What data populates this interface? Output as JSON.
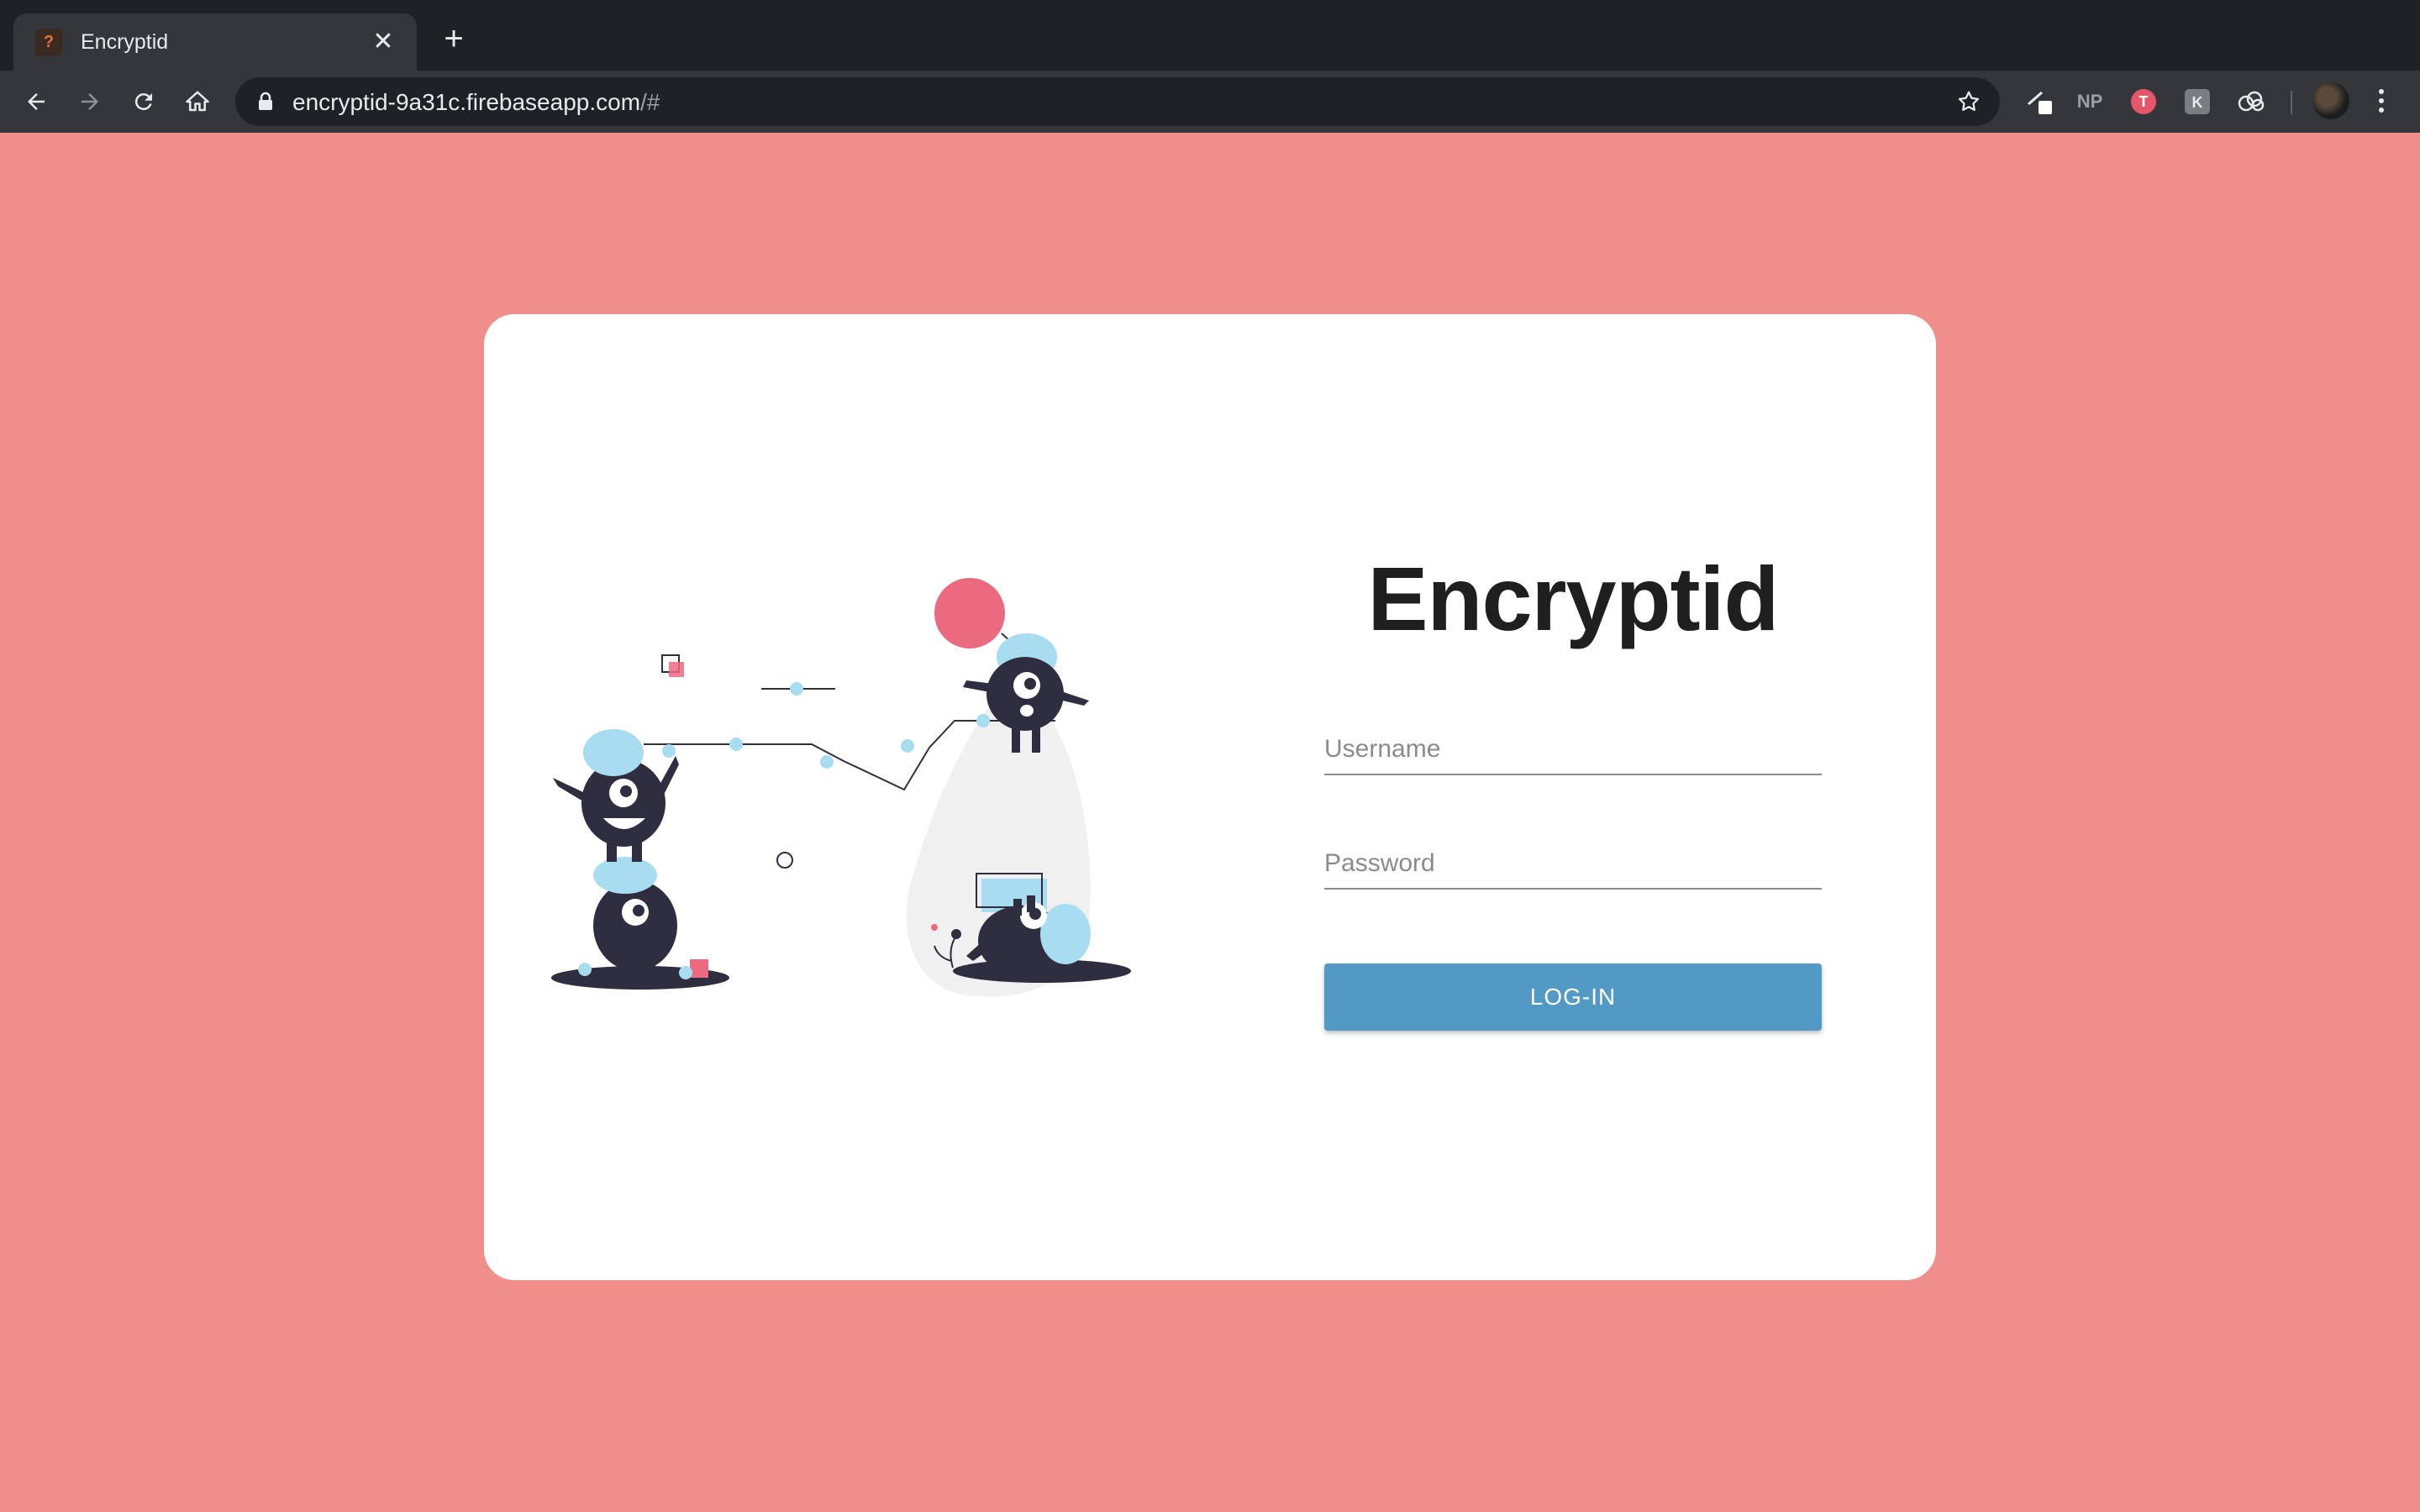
{
  "browser": {
    "tab_title": "Encryptid",
    "tab_close": "✕",
    "new_tab": "+",
    "url_main": "encryptid-9a31c.firebaseapp.com",
    "url_fragment": "/#",
    "extensions": [
      "pen-icon",
      "NP",
      "t-badge-icon",
      "k-badge-icon",
      "cloud-icon"
    ],
    "extension_np_label": "NP"
  },
  "login": {
    "title": "Encryptid",
    "username_placeholder": "Username",
    "password_placeholder": "Password",
    "button_label": "LOG-IN"
  },
  "colors": {
    "page_background": "#ef8e8a",
    "card_background": "#ffffff",
    "button": "#5299c5",
    "accent_pink": "#ec6a7f",
    "accent_blue": "#a8dcf0",
    "creature": "#2f2e41"
  }
}
